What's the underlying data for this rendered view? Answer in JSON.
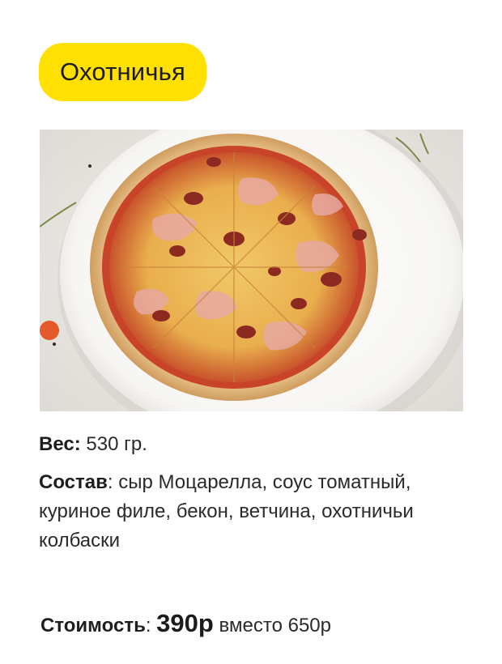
{
  "title": "Охотничья",
  "image": {
    "subject": "pizza-photo"
  },
  "weight": {
    "label": "Вес:",
    "value": "530 гр."
  },
  "composition": {
    "label": "Состав",
    "separator": ":",
    "value": "сыр Моцарелла, соус томатный, куриное филе, бекон, ветчина, охотничьи колбаски"
  },
  "price": {
    "label": "Стоимость",
    "separator": ":",
    "current": "390р",
    "instead_word": "вместо",
    "old": "650р"
  },
  "colors": {
    "accent": "#ffe000",
    "text": "#222222",
    "background": "#ffffff"
  }
}
